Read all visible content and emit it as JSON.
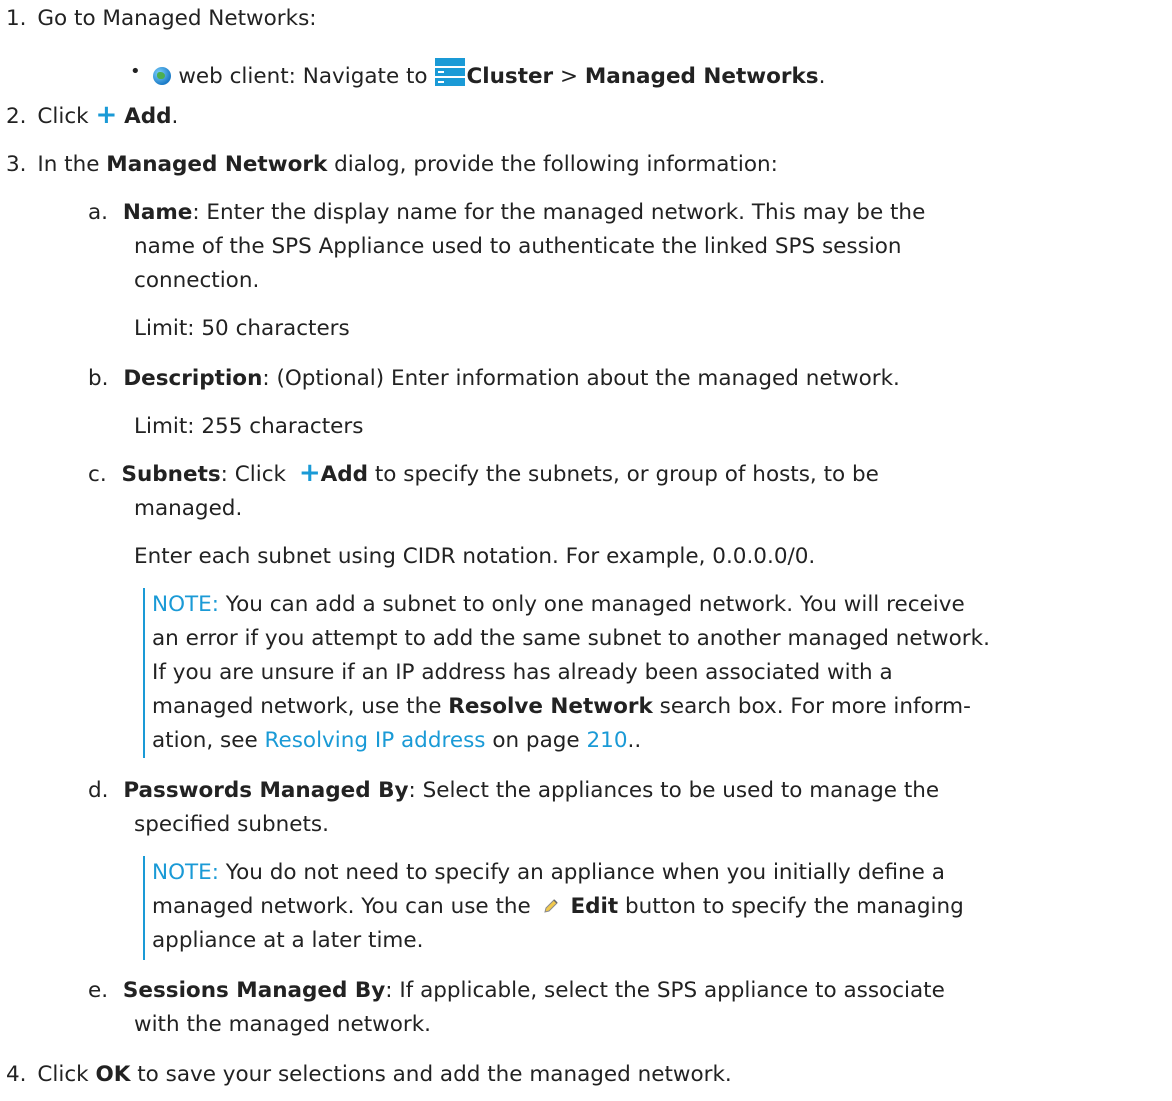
{
  "steps": {
    "s1": {
      "num": "1.",
      "text": "Go to Managed Networks:"
    },
    "s1_bullet": {
      "bullet": "•",
      "prefix": "web client: Navigate to",
      "cluster": "Cluster",
      "sep": " > ",
      "managed": "Managed Networks",
      "end": "."
    },
    "s2": {
      "num": "2.",
      "pre": "Click",
      "plus": "+",
      "add": "Add",
      "end": "."
    },
    "s3": {
      "num": "3.",
      "pre": "In the",
      "dialog": "Managed Network",
      "post": "dialog, provide the following information:"
    },
    "a": {
      "letter": "a.",
      "label": "Name",
      "text": ": Enter the display name for the managed network. This may be the",
      "text2": "name of the SPS Appliance used to authenticate the linked SPS session",
      "text3": "connection.",
      "limit": "Limit: 50 characters"
    },
    "b": {
      "letter": "b.",
      "label": "Description",
      "text": ": (Optional) Enter information about the managed network.",
      "limit": "Limit: 255 characters"
    },
    "c": {
      "letter": "c.",
      "label": "Subnets",
      "pre": ":  Click",
      "plus": "+",
      "add": "Add",
      "text": " to  specify  the  subnets,  or  group  of  hosts,  to  be",
      "text2": "managed.",
      "cidr": "Enter each subnet using CIDR notation. For example, 0.0.0.0/0.",
      "note_label": "NOTE:",
      "note1": " You can add a subnet to only one managed network. You will receive",
      "note2": "an error if you attempt to add the same subnet to another managed network.",
      "note3": "If you are unsure if an IP address has already been associated with a",
      "note4_pre": "managed network, use the ",
      "note4_bold": "Resolve Network",
      "note4_post": " search box. For more inform-",
      "note5_link": "Resolving IP address",
      "note5_mid": " on page ",
      "note5_page": "210",
      "note5_pre": "ation, see ",
      "note5_end": ".."
    },
    "d": {
      "letter": "d.",
      "label": "Passwords Managed By",
      "text": ": Select the appliances to be used to manage the",
      "text2": "specified subnets.",
      "note_label": "NOTE:",
      "note1": " You do not need to specify an appliance when you initially define a",
      "note2_pre": "managed network. You can use the",
      "note2_edit": "Edit",
      "note2_post": " button to specify the managing",
      "note3": "appliance at a later time."
    },
    "e": {
      "letter": "e.",
      "label": "Sessions Managed By",
      "text": ": If applicable, select the SPS appliance to associate",
      "text2": "with the managed network."
    },
    "s4": {
      "num": "4.",
      "pre": "Click",
      "ok": "OK",
      "post": " to save your selections and add the managed network."
    }
  },
  "icons": {
    "globe": "globe-icon",
    "cluster": "cluster-icon",
    "plus": "plus-icon",
    "edit": "pencil-icon"
  },
  "colors": {
    "accent": "#1a9ad6",
    "text": "#222222"
  }
}
